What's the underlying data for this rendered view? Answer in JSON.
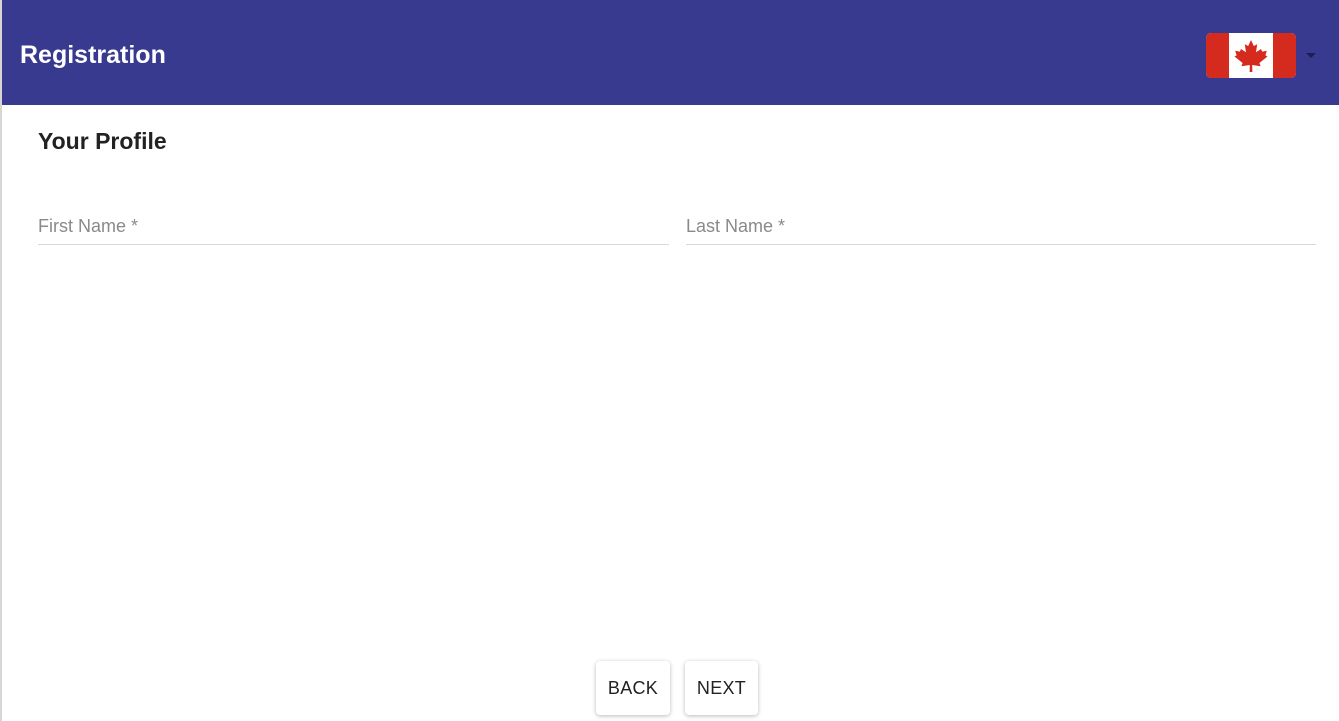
{
  "header": {
    "title": "Registration",
    "language": {
      "selected": "Canada",
      "flag_icon": "canada-flag-icon"
    }
  },
  "profile": {
    "title": "Your Profile",
    "first_name": {
      "placeholder": "First Name *",
      "value": ""
    },
    "last_name": {
      "placeholder": "Last Name *",
      "value": ""
    }
  },
  "actions": {
    "back_label": "BACK",
    "next_label": "NEXT"
  },
  "colors": {
    "app_bar": "#373a8f",
    "flag_red": "#d52b1e",
    "surface": "#ffffff"
  }
}
